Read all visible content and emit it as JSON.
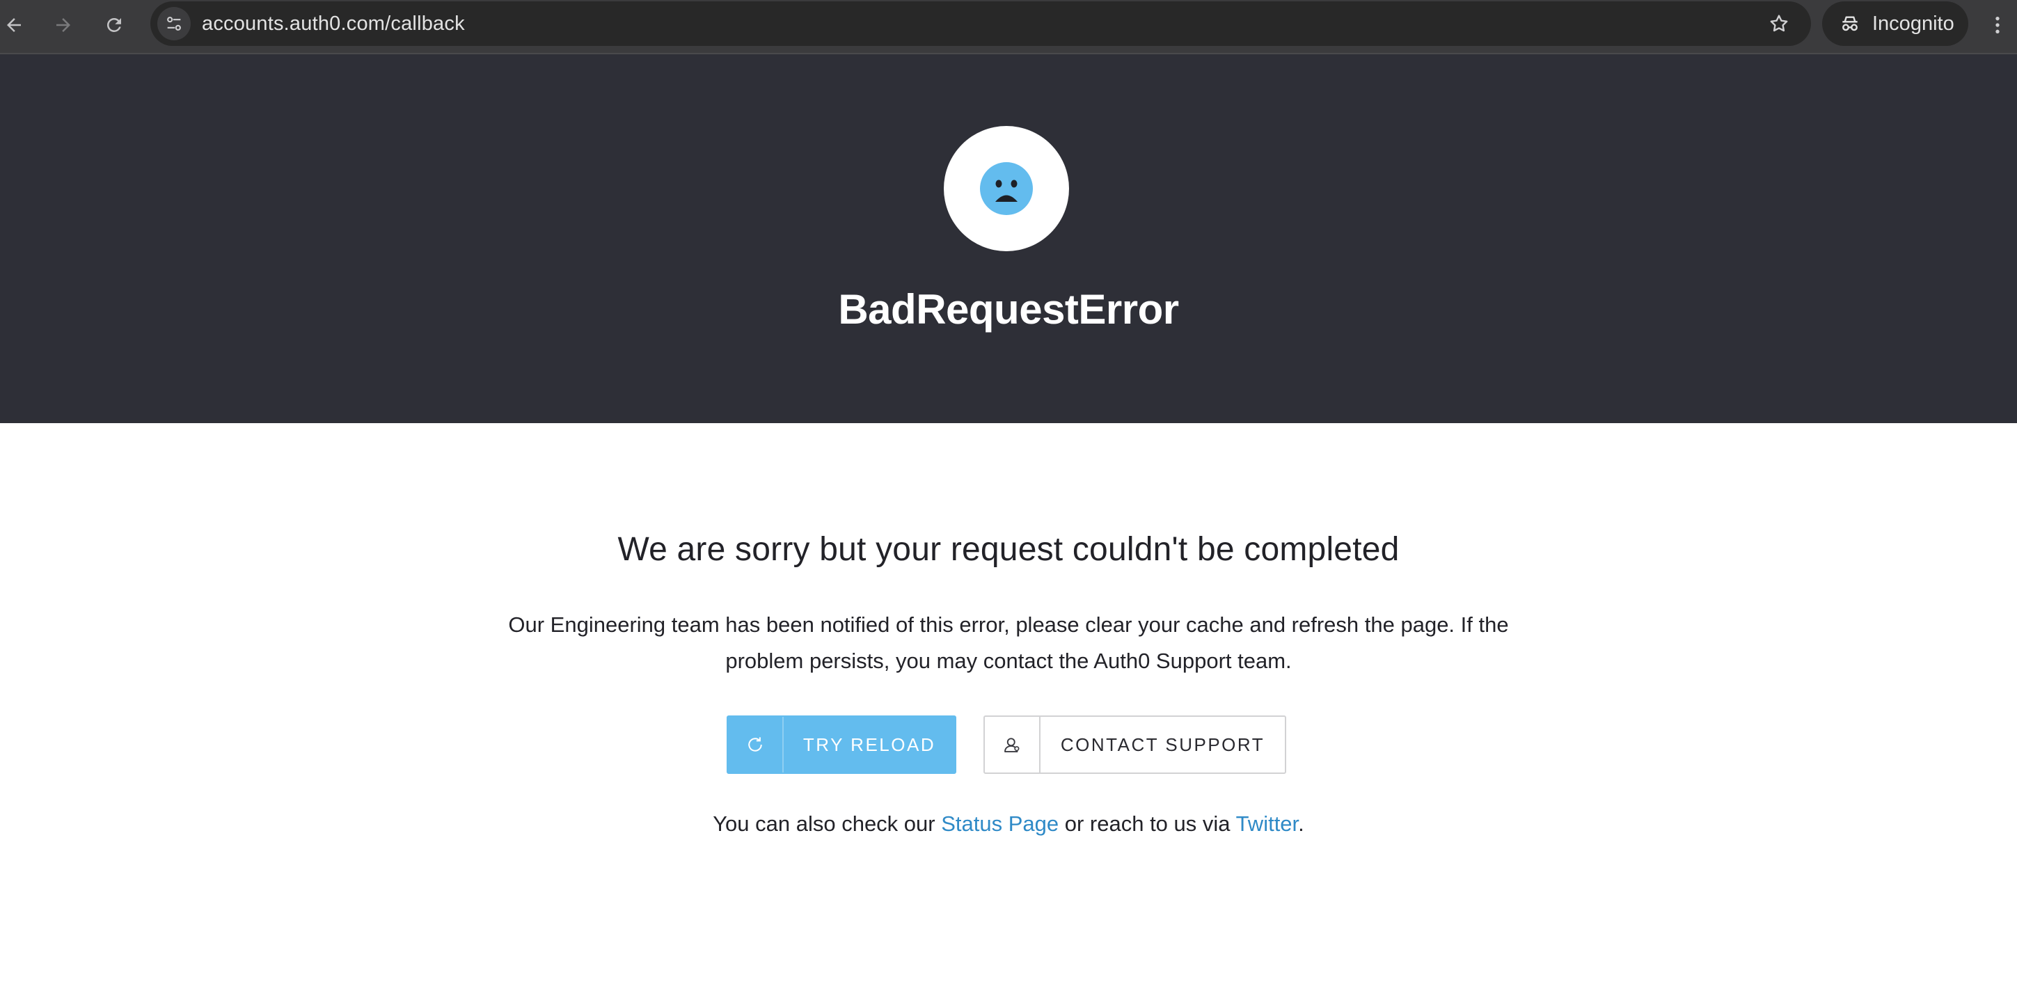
{
  "browser": {
    "url": "accounts.auth0.com/callback",
    "incognito_label": "Incognito",
    "icons": {
      "back": "back-arrow-icon",
      "forward": "forward-arrow-icon",
      "reload": "reload-icon",
      "site_info": "tune-icon",
      "bookmark": "star-icon",
      "incognito": "incognito-icon",
      "menu": "kebab-menu-icon"
    }
  },
  "error": {
    "icon": "sad-face-icon",
    "title": "BadRequestError",
    "heading": "We are sorry but your request couldn't be completed",
    "message": "Our Engineering team has been notified of this error, please clear your cache and refresh the page. If the problem persists, you may contact the Auth0 Support team.",
    "buttons": {
      "reload_label": "TRY RELOAD",
      "support_label": "CONTACT SUPPORT"
    },
    "footer": {
      "prefix": "You can also check our ",
      "status_link": "Status Page",
      "middle": " or reach to us via ",
      "twitter_link": "Twitter",
      "suffix": "."
    }
  },
  "colors": {
    "header_bg": "#2e2f37",
    "accent": "#63bcee",
    "link": "#2f8ac7"
  }
}
